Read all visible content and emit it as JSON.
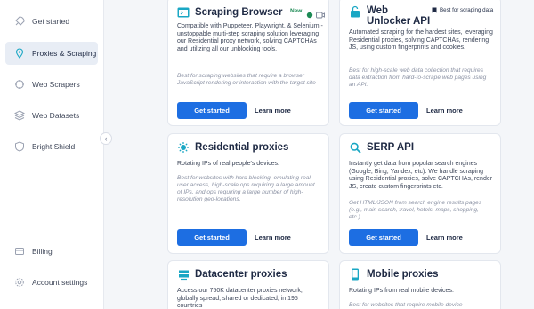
{
  "sidebar": {
    "items": [
      {
        "label": "Get started",
        "icon": "rocket-icon",
        "active": false
      },
      {
        "label": "Proxies & Scraping",
        "icon": "location-pin-icon",
        "active": true
      },
      {
        "label": "Web Scrapers",
        "icon": "scraper-icon",
        "active": false
      },
      {
        "label": "Web Datasets",
        "icon": "datasets-icon",
        "active": false
      },
      {
        "label": "Bright Shield",
        "icon": "shield-icon",
        "active": false
      }
    ],
    "bottom_items": [
      {
        "label": "Billing",
        "icon": "billing-icon"
      },
      {
        "label": "Account settings",
        "icon": "gear-icon"
      }
    ],
    "collapse_glyph": "‹"
  },
  "cards": {
    "scraping_browser": {
      "title": "Scraping Browser",
      "badge": "New",
      "description": "Compatible with Puppeteer, Playwright, & Selenium - unstoppable multi-step scraping solution leveraging our Residential proxy network, solving CAPTCHAs and utilizing all our unblocking tools.",
      "note": "Best for scraping websites that require a browser JavaScript rendering or interaction with the target site",
      "primary": "Get started",
      "secondary": "Learn more"
    },
    "web_unlocker": {
      "title": "Web Unlocker API",
      "badge": "Best for scraping data",
      "description": "Automated scraping for the hardest sites, leveraging Residential proxies, solving CAPTCHAs, rendering JS, using custom fingerprints and cookies.",
      "note": "Best for high-scale web data collection that requires data extraction from hard-to-scrape web pages using an API.",
      "primary": "Get started",
      "secondary": "Learn more"
    },
    "residential": {
      "title": "Residential proxies",
      "description": "Rotating IPs of real people's devices.",
      "note": "Best for websites with hard blocking, emulating real-user access, high-scale ops requiring a large amount of IPs, and ops requiring a large number of high-resolution geo-locations.",
      "primary": "Get started",
      "secondary": "Learn more"
    },
    "serp": {
      "title": "SERP API",
      "description": "Instantly get data from popular search engines (Google, Bing, Yandex, etc). We handle scraping using Residential proxies, solve CAPTCHAs, render JS, create custom fingerprints etc.",
      "note": "Get HTML/JSON from search engine results pages (e.g., main search, travel, hotels, maps, shopping, etc.).",
      "primary": "Get started",
      "secondary": "Learn more"
    },
    "datacenter": {
      "title": "Datacenter proxies",
      "description": "Access our 750K datacenter proxies network, globally spread, shared or dedicated, in 195 countries"
    },
    "mobile": {
      "title": "Mobile proxies",
      "description": "Rotating IPs from real mobile devices.",
      "note": "Best for websites that require mobile device"
    }
  },
  "colors": {
    "accent": "#1d6ee2",
    "icon": "#1aa7c4",
    "new_badge": "#1d8a55"
  }
}
